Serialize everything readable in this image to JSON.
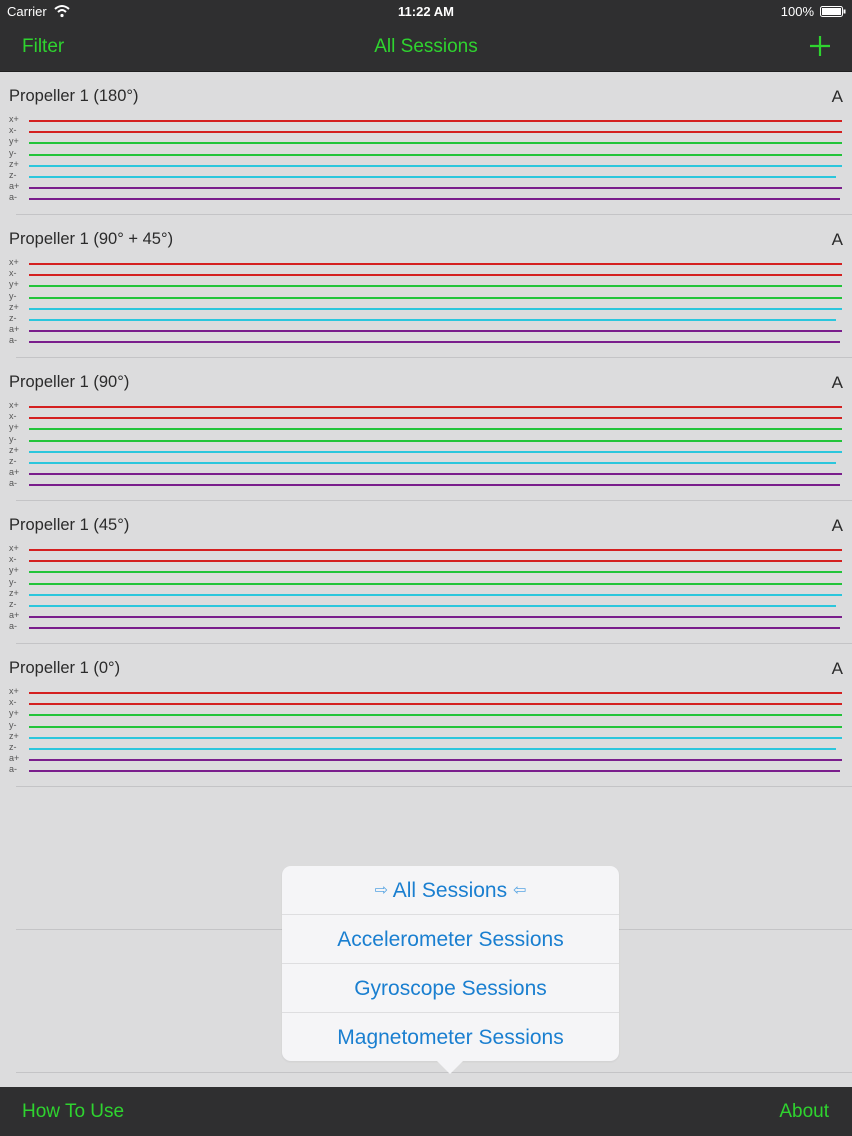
{
  "status_bar": {
    "carrier": "Carrier",
    "time": "11:22 AM",
    "battery": "100%"
  },
  "nav_bar": {
    "filter_label": "Filter",
    "title": "All Sessions",
    "add_icon": "plus-icon",
    "accent_color": "#2fd32f"
  },
  "axis_colors": {
    "x": "#d42020",
    "y": "#22c43a",
    "z": "#2bc6dc",
    "a": "#7a1e8c"
  },
  "sessions": [
    {
      "title": "Propeller 1 (180°)",
      "badge": "A",
      "axes": [
        {
          "label": "x+",
          "color_key": "x"
        },
        {
          "label": "x-",
          "color_key": "x"
        },
        {
          "label": "y+",
          "color_key": "y"
        },
        {
          "label": "y-",
          "color_key": "y"
        },
        {
          "label": "z+",
          "color_key": "z"
        },
        {
          "label": "z-",
          "color_key": "z"
        },
        {
          "label": "a+",
          "color_key": "a"
        },
        {
          "label": "a-",
          "color_key": "a"
        }
      ]
    },
    {
      "title": "Propeller 1 (90° + 45°)",
      "badge": "A",
      "axes": [
        {
          "label": "x+",
          "color_key": "x"
        },
        {
          "label": "x-",
          "color_key": "x"
        },
        {
          "label": "y+",
          "color_key": "y"
        },
        {
          "label": "y-",
          "color_key": "y"
        },
        {
          "label": "z+",
          "color_key": "z"
        },
        {
          "label": "z-",
          "color_key": "z"
        },
        {
          "label": "a+",
          "color_key": "a"
        },
        {
          "label": "a-",
          "color_key": "a"
        }
      ]
    },
    {
      "title": "Propeller 1 (90°)",
      "badge": "A",
      "axes": [
        {
          "label": "x+",
          "color_key": "x"
        },
        {
          "label": "x-",
          "color_key": "x"
        },
        {
          "label": "y+",
          "color_key": "y"
        },
        {
          "label": "y-",
          "color_key": "y"
        },
        {
          "label": "z+",
          "color_key": "z"
        },
        {
          "label": "z-",
          "color_key": "z"
        },
        {
          "label": "a+",
          "color_key": "a"
        },
        {
          "label": "a-",
          "color_key": "a"
        }
      ]
    },
    {
      "title": "Propeller 1 (45°)",
      "badge": "A",
      "axes": [
        {
          "label": "x+",
          "color_key": "x"
        },
        {
          "label": "x-",
          "color_key": "x"
        },
        {
          "label": "y+",
          "color_key": "y"
        },
        {
          "label": "y-",
          "color_key": "y"
        },
        {
          "label": "z+",
          "color_key": "z"
        },
        {
          "label": "z-",
          "color_key": "z"
        },
        {
          "label": "a+",
          "color_key": "a"
        },
        {
          "label": "a-",
          "color_key": "a"
        }
      ]
    },
    {
      "title": "Propeller 1 (0°)",
      "badge": "A",
      "axes": [
        {
          "label": "x+",
          "color_key": "x"
        },
        {
          "label": "x-",
          "color_key": "x"
        },
        {
          "label": "y+",
          "color_key": "y"
        },
        {
          "label": "y-",
          "color_key": "y"
        },
        {
          "label": "z+",
          "color_key": "z"
        },
        {
          "label": "z-",
          "color_key": "z"
        },
        {
          "label": "a+",
          "color_key": "a"
        },
        {
          "label": "a-",
          "color_key": "a"
        }
      ]
    }
  ],
  "filter_popover": {
    "selected_marker_left": "⇨",
    "selected_marker_right": "⇦",
    "items": [
      {
        "label": "All Sessions",
        "selected": true
      },
      {
        "label": "Accelerometer Sessions",
        "selected": false
      },
      {
        "label": "Gyroscope Sessions",
        "selected": false
      },
      {
        "label": "Magnetometer Sessions",
        "selected": false
      }
    ],
    "text_color": "#1a7fd0"
  },
  "tab_bar": {
    "how_to_use_label": "How To Use",
    "about_label": "About"
  }
}
